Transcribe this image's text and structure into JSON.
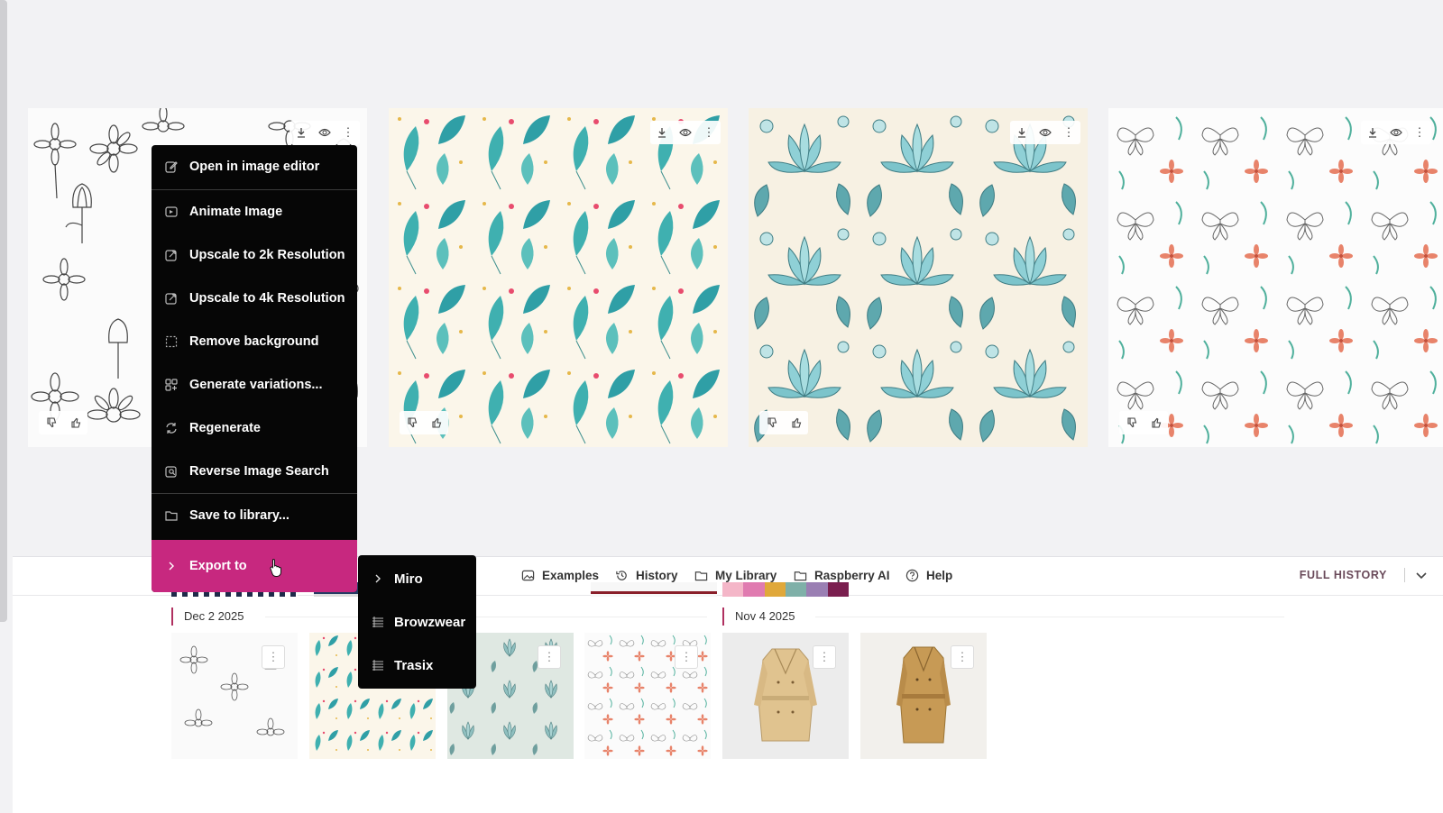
{
  "context_menu": {
    "items": [
      {
        "label": "Open in image editor",
        "icon": "edit-icon"
      },
      {
        "label": "Animate Image",
        "icon": "animate-icon"
      },
      {
        "label": "Upscale to 2k Resolution",
        "icon": "upscale-icon"
      },
      {
        "label": "Upscale to 4k Resolution",
        "icon": "upscale-icon"
      },
      {
        "label": "Remove background",
        "icon": "remove-background-icon"
      },
      {
        "label": "Generate variations...",
        "icon": "variations-icon"
      },
      {
        "label": "Regenerate",
        "icon": "regenerate-icon"
      },
      {
        "label": "Reverse Image Search",
        "icon": "reverse-search-icon"
      },
      {
        "label": "Save to library...",
        "icon": "folder-icon"
      },
      {
        "label": "Export to",
        "icon": "chevron-right-icon"
      }
    ]
  },
  "export_submenu": {
    "items": [
      {
        "label": "Miro",
        "icon": "chevron-right-icon"
      },
      {
        "label": "Browzwear",
        "icon": "browzwear-icon"
      },
      {
        "label": "Trasix",
        "icon": "trasix-icon"
      }
    ]
  },
  "tabs": [
    {
      "label": "Examples",
      "icon": "image-icon"
    },
    {
      "label": "History",
      "icon": "history-icon",
      "active": true
    },
    {
      "label": "My Library",
      "icon": "folder-icon"
    },
    {
      "label": "Raspberry AI",
      "icon": "folder-icon"
    },
    {
      "label": "Help",
      "icon": "help-icon"
    }
  ],
  "full_history_label": "FULL HISTORY",
  "history_groups": [
    {
      "date": "Dec 2 2025"
    },
    {
      "date": "Nov 4 2025"
    }
  ],
  "colors": {
    "accent": "#c7287f",
    "menu_bg": "#060606",
    "palette_swatches": [
      "#f4b6c8",
      "#e07bb0",
      "#e0a83a",
      "#7fb0a8",
      "#9a7fb3",
      "#7a1f4f"
    ]
  }
}
